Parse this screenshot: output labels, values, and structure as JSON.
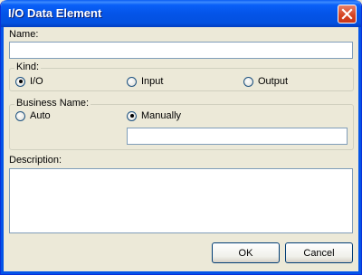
{
  "window": {
    "title": "I/O Data Element"
  },
  "name_field": {
    "label": "Name:",
    "value": ""
  },
  "kind": {
    "label": "Kind:",
    "options": [
      {
        "label": "I/O",
        "selected": true
      },
      {
        "label": "Input",
        "selected": false
      },
      {
        "label": "Output",
        "selected": false
      }
    ]
  },
  "business_name": {
    "label": "Business Name:",
    "options": [
      {
        "label": "Auto",
        "selected": false
      },
      {
        "label": "Manually",
        "selected": true
      }
    ],
    "value": ""
  },
  "description": {
    "label": "Description:",
    "value": ""
  },
  "buttons": {
    "ok": "OK",
    "cancel": "Cancel"
  }
}
